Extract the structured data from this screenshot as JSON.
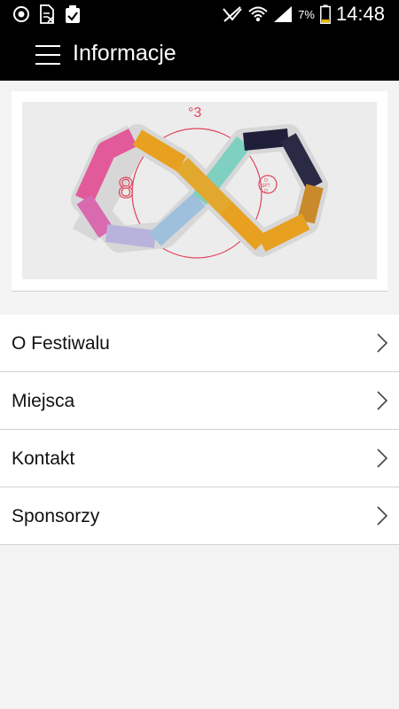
{
  "status_bar": {
    "time": "14:48",
    "battery_percent": "7%",
    "icons": [
      "app-icon",
      "file-icon",
      "clipboard-check-icon",
      "no-signal-icon",
      "wifi-icon",
      "cell-signal-icon",
      "battery-icon"
    ]
  },
  "app_bar": {
    "title": "Informacje",
    "menu_icon": "hamburger-icon"
  },
  "banner": {
    "marks": {
      "degree_number": "°3",
      "left_symbol": "8",
      "right_symbol_lines": [
        "O",
        "SPT",
        "O"
      ]
    },
    "colors": {
      "background": "#ececec",
      "circle": "#e0445a",
      "pink": "#e25a9a",
      "orange": "#e8a020",
      "mint": "#7fd0c0",
      "lavender": "#b8b3dc",
      "navy": "#1f1f3a",
      "red": "#e0445a"
    }
  },
  "menu": {
    "items": [
      {
        "label": "O Festiwalu"
      },
      {
        "label": "Miejsca"
      },
      {
        "label": "Kontakt"
      },
      {
        "label": "Sponsorzy"
      }
    ],
    "chevron_icon": "chevron-right-icon"
  }
}
